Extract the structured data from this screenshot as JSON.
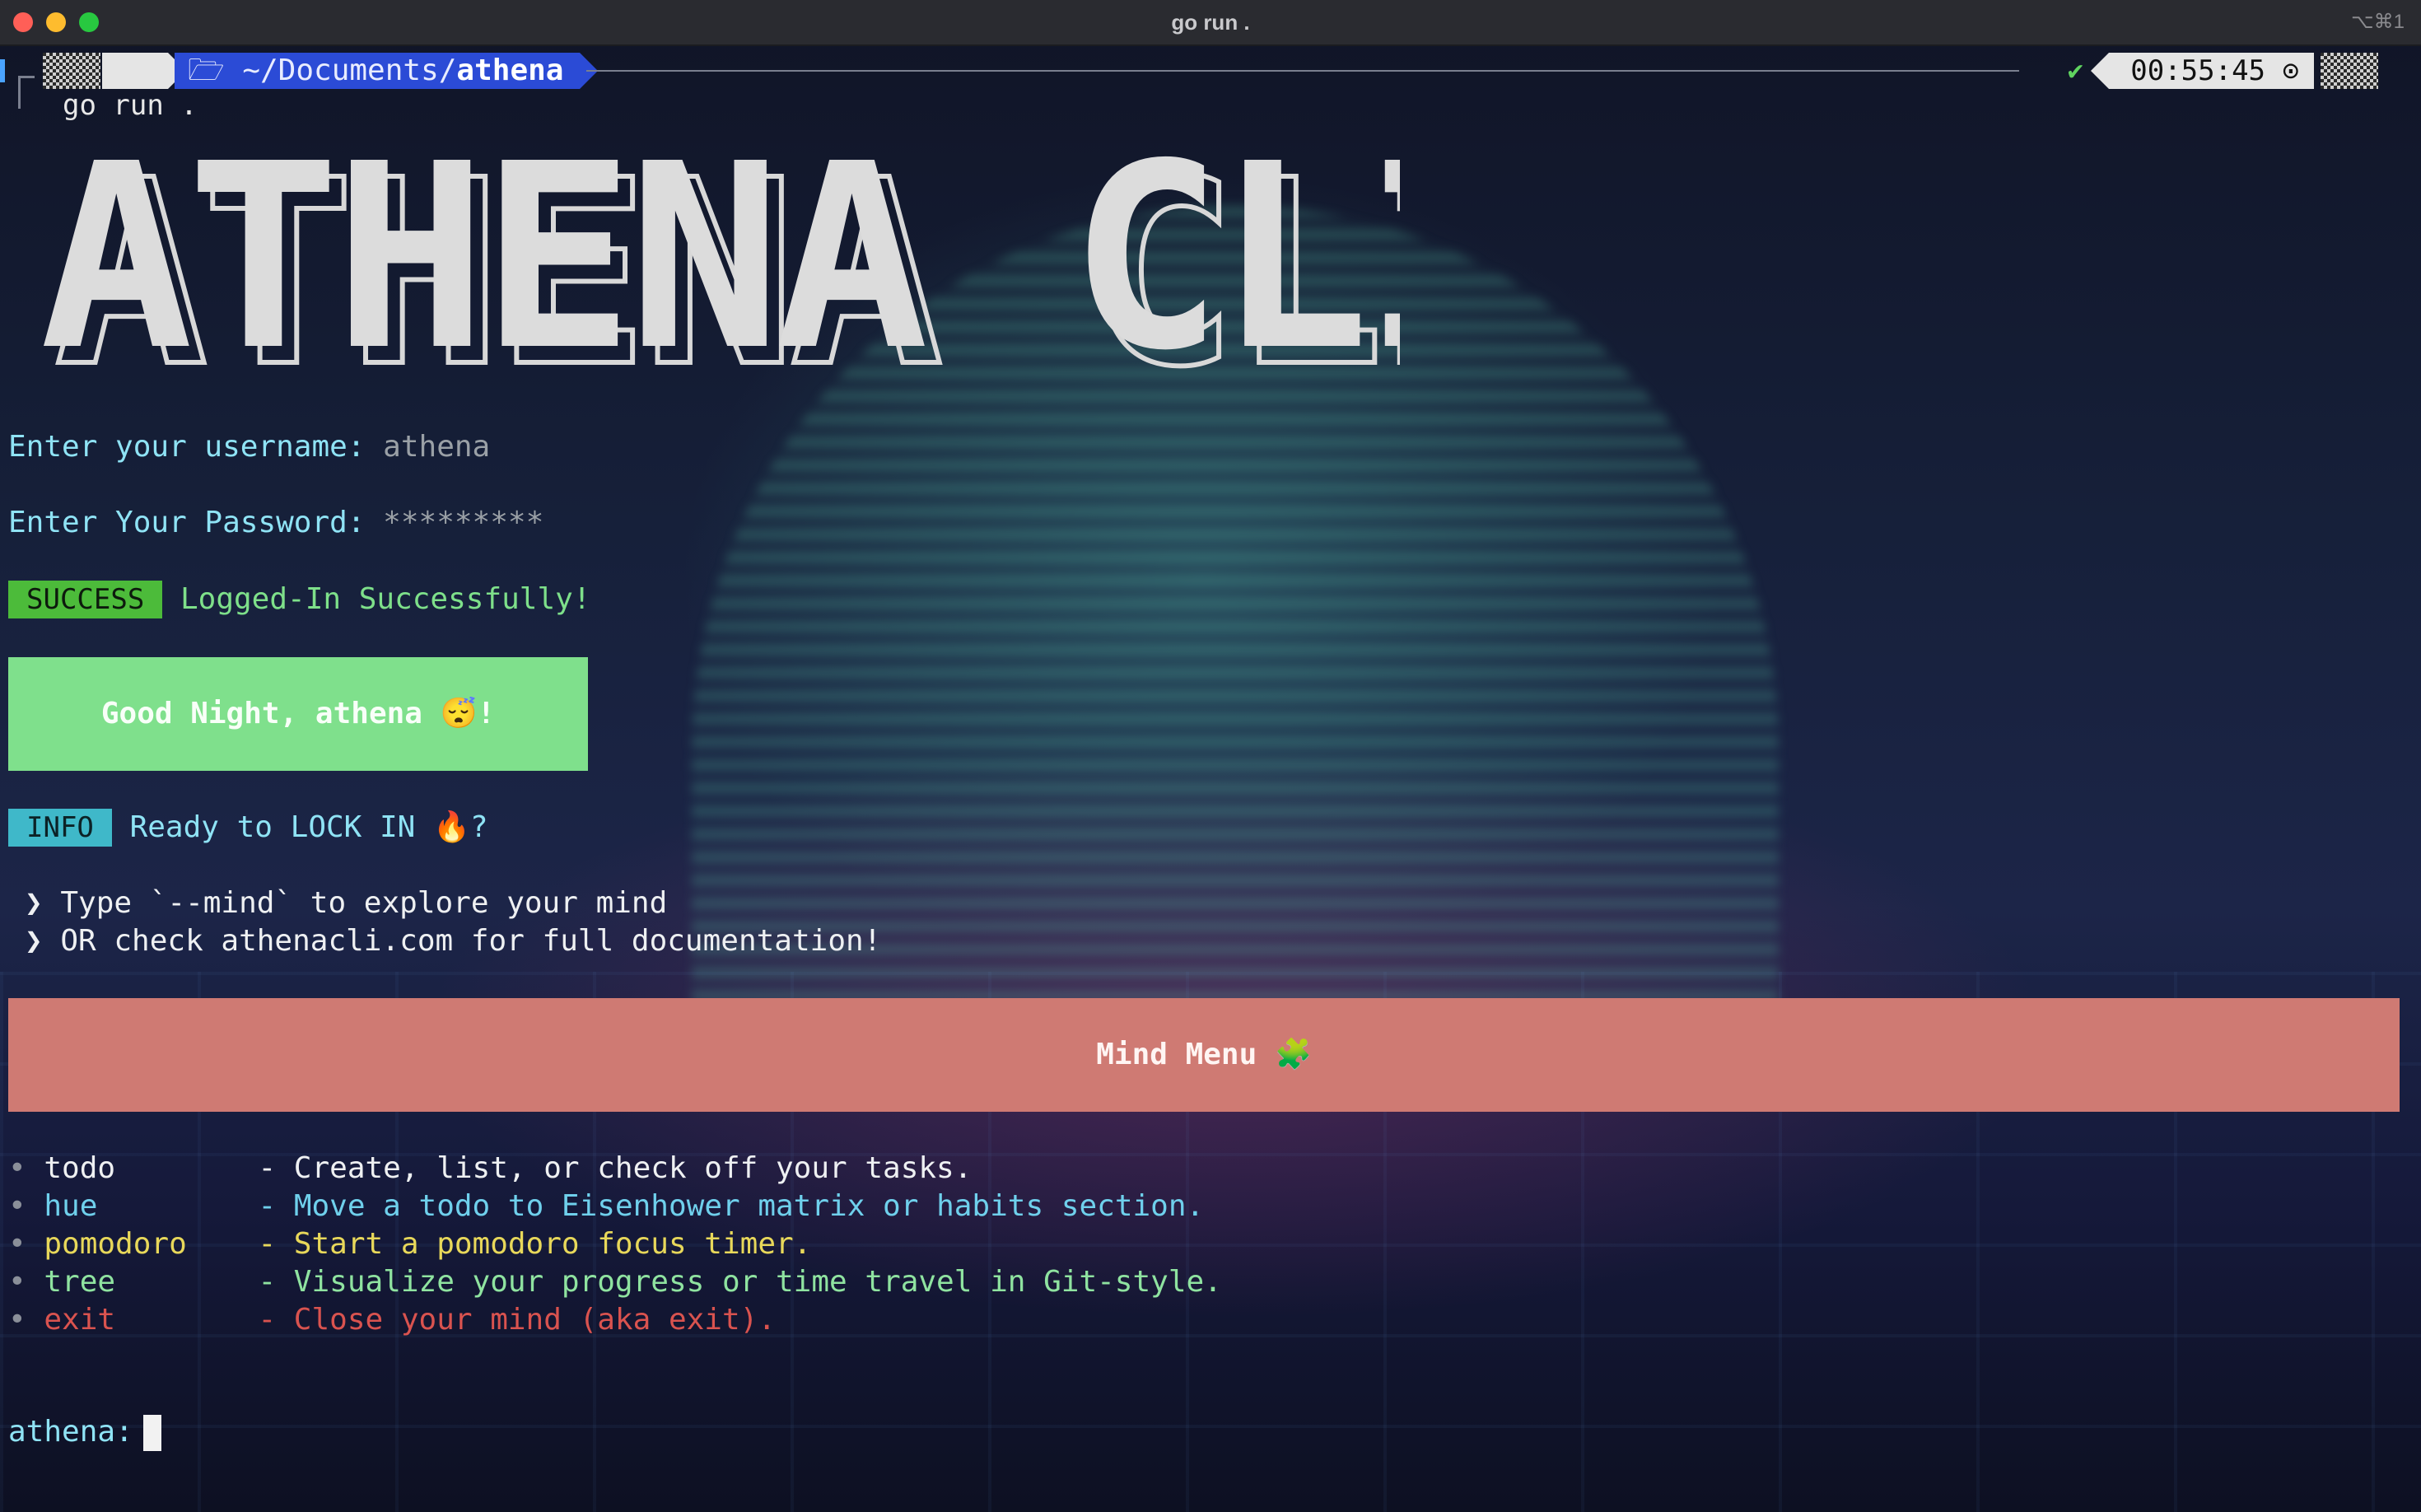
{
  "window": {
    "title": "go run .",
    "shortcut": "⌥⌘1"
  },
  "promptbar": {
    "apple_icon": "apple-icon",
    "folder_icon": "folder-icon",
    "path_prefix": "~/Documents/",
    "path_dir": "athena",
    "status_check": "✔",
    "clock": "00:55:45",
    "clock_icon": "clock-icon"
  },
  "command": "go run .",
  "banner": "ATHENA CLI",
  "login": {
    "username_label": "Enter your username:",
    "username_value": "athena",
    "password_label": "Enter Your Password:",
    "password_value": "*********"
  },
  "success": {
    "badge": "SUCCESS",
    "message": "Logged-In Successfully!"
  },
  "greeting": "Good Night, athena 😴!",
  "info": {
    "badge": "INFO",
    "message": "Ready to LOCK IN 🔥?"
  },
  "hints": [
    "❯ Type `--mind` to explore your mind",
    "❯ OR check athenacli.com for full documentation!"
  ],
  "mind_menu_title": "Mind Menu 🧩",
  "menu": [
    {
      "cmd": "todo",
      "desc": "- Create, list, or check off your tasks.",
      "color": "#eef0f2"
    },
    {
      "cmd": "hue",
      "desc": "- Move a todo to Eisenhower matrix or habits section.",
      "color": "#6fd0ec"
    },
    {
      "cmd": "pomodoro",
      "desc": "- Start a pomodoro focus timer.",
      "color": "#e8d85a"
    },
    {
      "cmd": "tree",
      "desc": "- Visualize your progress or time travel in Git-style.",
      "color": "#8fe3a0"
    },
    {
      "cmd": "exit",
      "desc": "- Close your mind (aka exit).",
      "color": "#d9534f"
    }
  ],
  "input_prompt": "athena:"
}
